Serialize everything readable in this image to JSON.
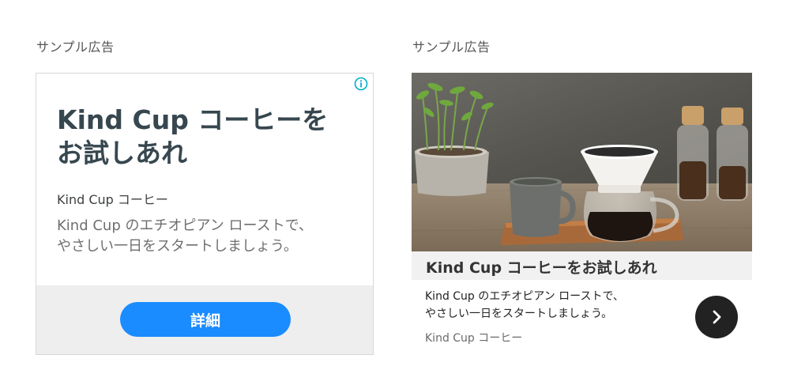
{
  "left_ad": {
    "section_label": "サンプル広告",
    "info_icon": "info-circle-icon",
    "headline_line1": "Kind Cup コーヒーを",
    "headline_line2": "お試しあれ",
    "advertiser": "Kind Cup コーヒー",
    "description_line1": "Kind Cup のエチオピアン ローストで、",
    "description_line2": "やさしい一日をスタートしましょう。",
    "cta_label": "詳細",
    "cta_color": "#1a8cff"
  },
  "right_ad": {
    "section_label": "サンプル広告",
    "image": "coffee-dripper-photo",
    "headline": "Kind Cup コーヒーをお試しあれ",
    "description_line1": "Kind Cup のエチオピアン ローストで、",
    "description_line2": "やさしい一日をスタートしましょう。",
    "advertiser": "Kind Cup コーヒー",
    "next_icon": "chevron-right-icon"
  }
}
